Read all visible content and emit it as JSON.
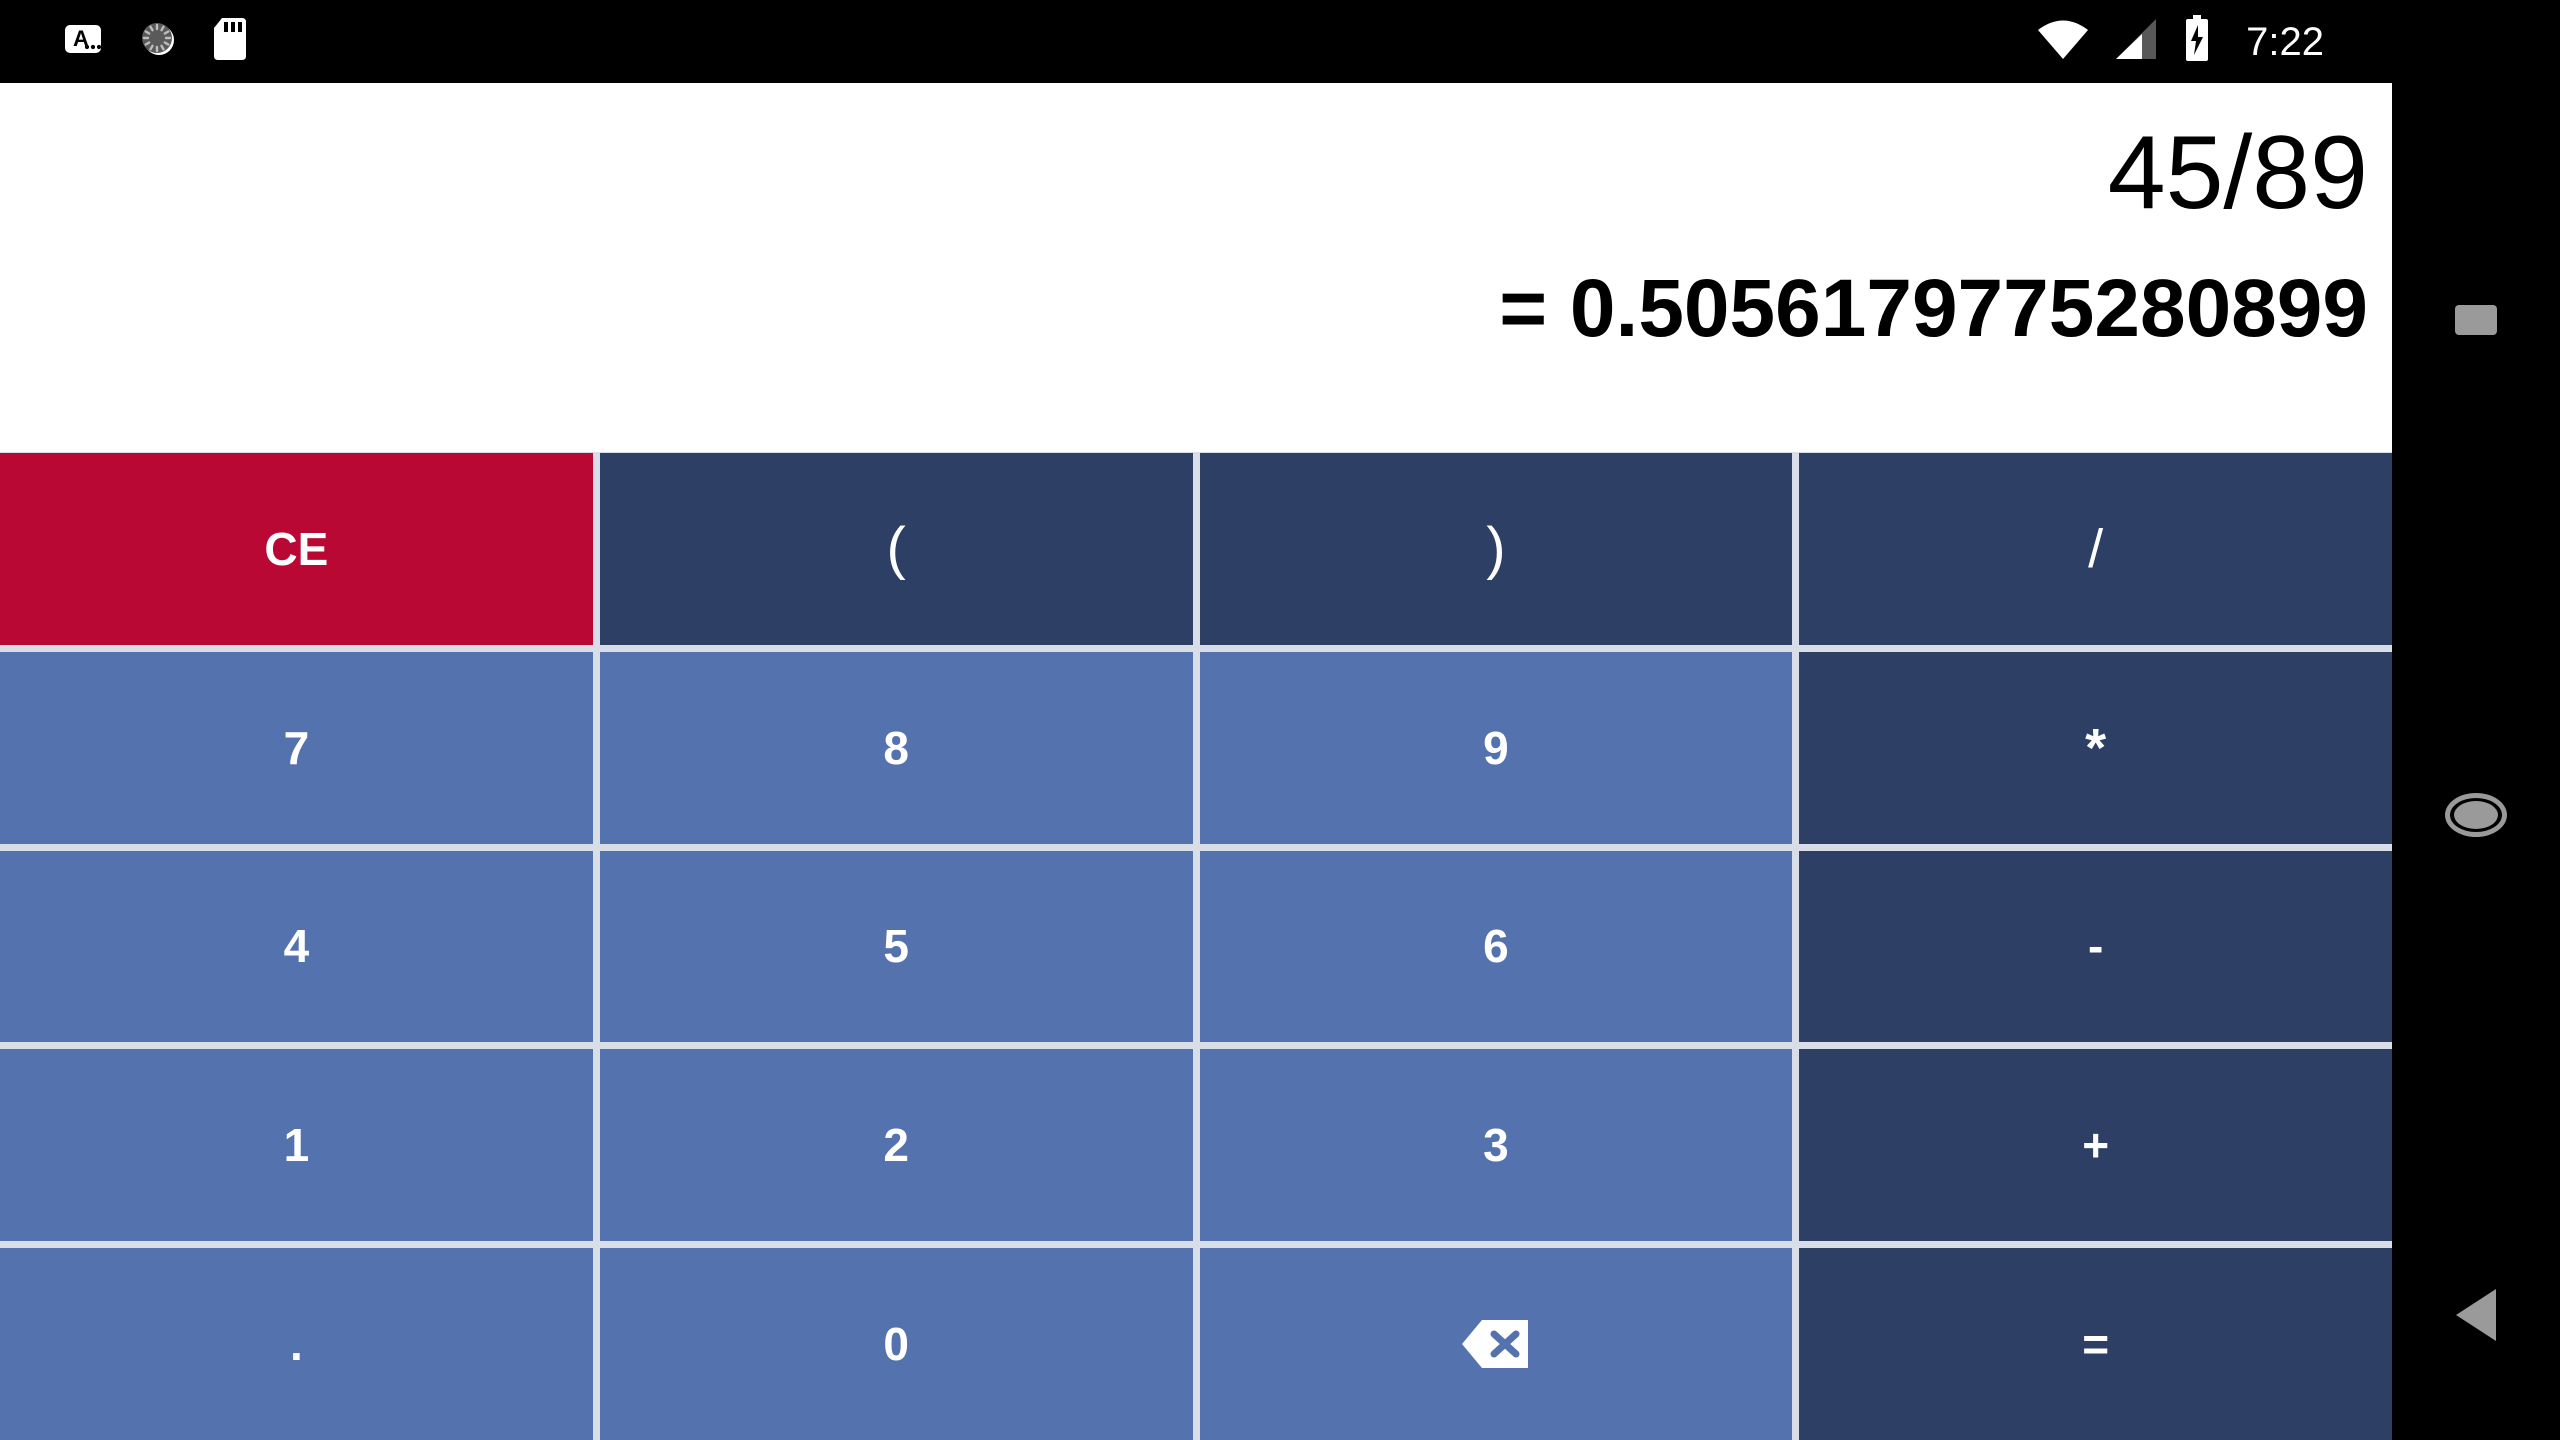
{
  "status_bar": {
    "left_icons": [
      {
        "name": "input-method-icon",
        "label": "A"
      },
      {
        "name": "sync-spinner-icon",
        "label": ""
      },
      {
        "name": "sd-card-icon",
        "label": ""
      }
    ],
    "right_icons": [
      {
        "name": "wifi-icon",
        "label": ""
      },
      {
        "name": "cellular-signal-icon",
        "label": ""
      },
      {
        "name": "battery-charging-icon",
        "label": ""
      }
    ],
    "clock": "7:22"
  },
  "display": {
    "expression": "45/89",
    "result": "= 0.5056179775280899"
  },
  "keypad": {
    "rows": [
      [
        {
          "label": "CE",
          "style": "clear",
          "name": "key-clear-entry"
        },
        {
          "label": "(",
          "style": "op",
          "name": "key-open-paren"
        },
        {
          "label": ")",
          "style": "op",
          "name": "key-close-paren"
        },
        {
          "label": "/",
          "style": "op",
          "name": "key-divide"
        }
      ],
      [
        {
          "label": "7",
          "style": "num",
          "name": "key-7"
        },
        {
          "label": "8",
          "style": "num",
          "name": "key-8"
        },
        {
          "label": "9",
          "style": "num",
          "name": "key-9"
        },
        {
          "label": "*",
          "style": "op",
          "name": "key-multiply"
        }
      ],
      [
        {
          "label": "4",
          "style": "num",
          "name": "key-4"
        },
        {
          "label": "5",
          "style": "num",
          "name": "key-5"
        },
        {
          "label": "6",
          "style": "num",
          "name": "key-6"
        },
        {
          "label": "-",
          "style": "op",
          "name": "key-subtract"
        }
      ],
      [
        {
          "label": "1",
          "style": "num",
          "name": "key-1"
        },
        {
          "label": "2",
          "style": "num",
          "name": "key-2"
        },
        {
          "label": "3",
          "style": "num",
          "name": "key-3"
        },
        {
          "label": "+",
          "style": "op",
          "name": "key-add"
        }
      ],
      [
        {
          "label": ".",
          "style": "num",
          "name": "key-decimal-point"
        },
        {
          "label": "0",
          "style": "num",
          "name": "key-0"
        },
        {
          "label": "",
          "style": "num",
          "name": "key-backspace",
          "icon": "backspace-icon"
        },
        {
          "label": "=",
          "style": "op",
          "name": "key-equals"
        }
      ]
    ]
  },
  "navbar": {
    "buttons": [
      {
        "name": "nav-recents-button",
        "icon": "square-icon"
      },
      {
        "name": "nav-home-button",
        "icon": "circle-icon"
      },
      {
        "name": "nav-back-button",
        "icon": "triangle-left-icon"
      }
    ]
  },
  "colors": {
    "number_key": "#5473ae",
    "operator_key": "#2e3f66",
    "clear_key": "#ba0835",
    "display_bg": "#ffffff",
    "keypad_gap": "#d8dde8",
    "status_bar_bg": "#000000",
    "navbar_icon": "#9a9a9a"
  }
}
